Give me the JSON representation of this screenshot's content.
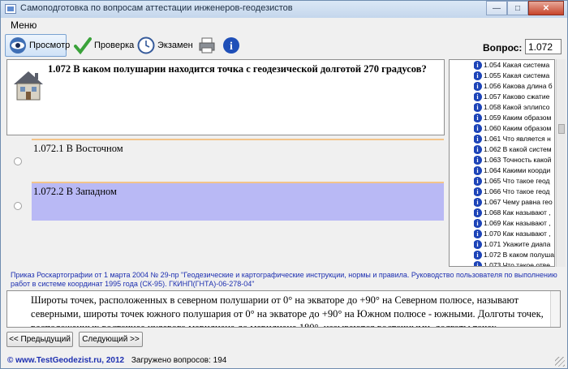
{
  "window": {
    "title": "Самоподготовка по вопросам  аттестации инженеров-геодезистов",
    "minimize": "—",
    "maximize": "□",
    "close": "✕"
  },
  "menu": {
    "items": [
      "Меню"
    ]
  },
  "toolbar": {
    "view_label": "Просмотр",
    "check_label": "Проверка",
    "exam_label": "Экзамен",
    "question_label": "Вопрос:",
    "question_value": "1.072"
  },
  "question": {
    "text": "1.072 В каком полушарии находится точка с геодезической долготой 270 градусов?"
  },
  "answers": [
    {
      "text": "1.072.1 В Восточном",
      "selected": false
    },
    {
      "text": "1.072.2 В Западном",
      "selected": true
    }
  ],
  "question_list": [
    "1.054 Какая система",
    "1.055 Какая система",
    "1.056 Какова длина б",
    "1.057 Каково сжатие",
    "1.058 Какой эллипсо",
    "1.059 Каким образом",
    "1.060 Каким образом",
    "1.061 Что является н",
    "1.062 В какой систем",
    "1.063 Точность какой",
    "1.064 Какими коорди",
    "1.065 Что такое геод",
    "1.066 Что такое геод",
    "1.067 Чему равна гео",
    "1.068 Как называют ,",
    "1.069 Как называют ,",
    "1.070 Как называют ,",
    "1.071 Укажите диапа",
    "1.072 В каком полуша",
    "1.073 Что такое отве"
  ],
  "source": "Приказ Роскартографии от 1 марта 2004 № 29-пр \"Геодезические и картографические инструкции, нормы и правила. Руководство пользователя по выполнению работ в системе координат 1995 года (СК-95). ГКИНП(ГНТА)-06-278-04\"",
  "explanation": "Широты точек, расположенных в северном полушарии от 0° на экваторе до +90° на Северном полюсе, называют северными, широты точек южного полушария от 0° на экваторе до +90° на Южном полюсе - южными. Долготы точек, расположенных восточнее нулевого меридиана до меридиана 180°, называются восточными, долготы точек",
  "nav": {
    "prev": "<< Предыдущий",
    "next": "Следующий >>"
  },
  "status": {
    "site": "© www.TestGeodezist.ru, 2012",
    "loaded": "Загружено вопросов: 194"
  },
  "colors": {
    "selected_answer": "#b9b9f5",
    "answer_separator": "#f3c48a",
    "info_icon": "#1d44b8",
    "link_text": "#1d2fb0"
  }
}
